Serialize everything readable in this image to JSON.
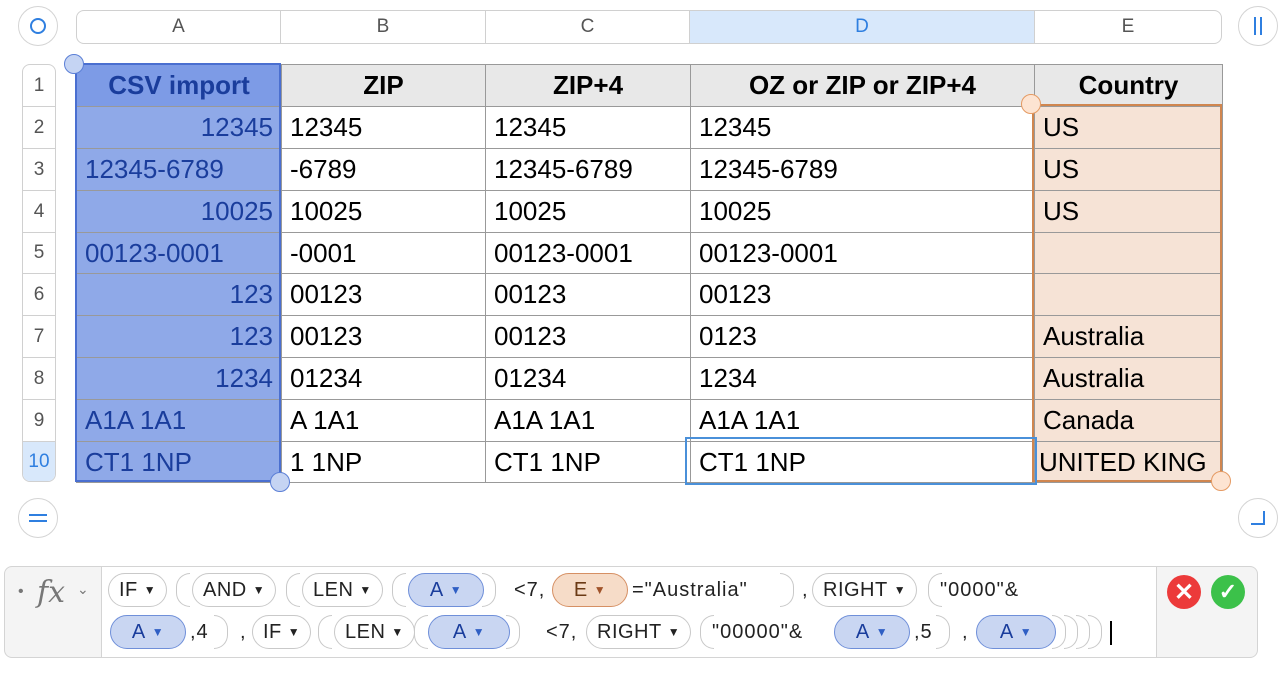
{
  "columns": [
    {
      "label": "A",
      "selected": false
    },
    {
      "label": "B",
      "selected": false
    },
    {
      "label": "C",
      "selected": false
    },
    {
      "label": "D",
      "selected": true
    },
    {
      "label": "E",
      "selected": false
    }
  ],
  "rows": [
    "1",
    "2",
    "3",
    "4",
    "5",
    "6",
    "7",
    "8",
    "9",
    "10"
  ],
  "table": {
    "headers": [
      "CSV import",
      "ZIP",
      "ZIP+4",
      "OZ or ZIP or ZIP+4",
      "Country"
    ],
    "body": [
      [
        "12345",
        "12345",
        "12345",
        "12345",
        "US"
      ],
      [
        "12345-6789",
        "-6789",
        "12345-6789",
        "12345-6789",
        "US"
      ],
      [
        "10025",
        "10025",
        "10025",
        "10025",
        "US"
      ],
      [
        "00123-0001",
        "-0001",
        "00123-0001",
        "00123-0001",
        ""
      ],
      [
        "123",
        "00123",
        "00123",
        "00123",
        ""
      ],
      [
        "123",
        "00123",
        "00123",
        "0123",
        "Australia"
      ],
      [
        "1234",
        "01234",
        "01234",
        "1234",
        "Australia"
      ],
      [
        "A1A 1A1",
        "A 1A1",
        "A1A 1A1",
        "A1A 1A1",
        "Canada"
      ],
      [
        "CT1 1NP",
        "1 1NP",
        "CT1 1NP",
        "CT1 1NP",
        "UNITED KING"
      ]
    ],
    "a_right_aligned": [
      true,
      false,
      true,
      false,
      true,
      true,
      true,
      false,
      false
    ]
  },
  "formula": {
    "fx_label": "fx",
    "tok_if": "IF",
    "tok_and": "AND",
    "tok_len": "LEN",
    "tok_right": "RIGHT",
    "ref_a": "A",
    "ref_e": "E",
    "lt7": "<7,",
    "eq_australia": "=\"Australia\"",
    "comma": ",",
    "str_0000": "\"0000\"&",
    "comma4": ",4",
    "str_00000": "\"00000\"&",
    "comma5": ",5"
  },
  "colors": {
    "selection_blue": "#8fa9e8",
    "reference_orange": "#f6e3d6",
    "cancel": "#ec3a3a",
    "accept": "#3cc14a"
  }
}
